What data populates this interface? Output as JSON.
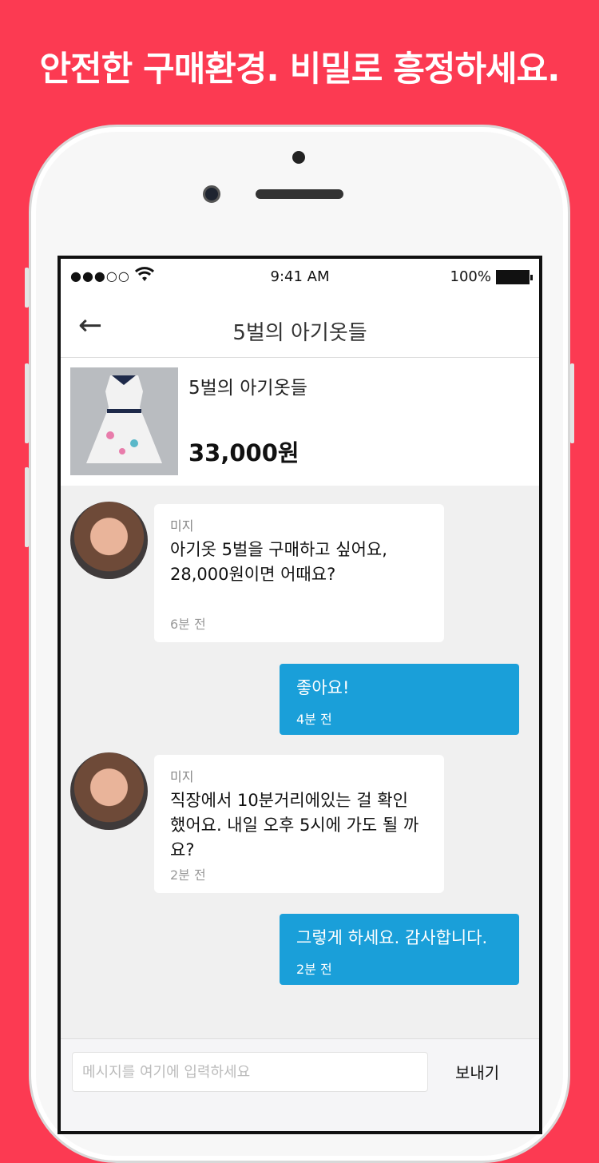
{
  "headline": "안전한 구매환경. 비밀로 흥정하세요.",
  "status_bar": {
    "signal": "●●●○○",
    "time": "9:41 AM",
    "battery": "100%"
  },
  "nav": {
    "title": "5벌의 아기옷들",
    "back_icon": "arrow-left-icon"
  },
  "product": {
    "name": "5벌의 아기옷들",
    "price": "33,000원"
  },
  "messages": [
    {
      "direction": "in",
      "sender": "미지",
      "text": "아기옷 5벌을 구매하고 싶어요, 28,000원이면 어때요?",
      "time": "6분 전"
    },
    {
      "direction": "out",
      "text": "좋아요!",
      "time": "4분 전"
    },
    {
      "direction": "in",
      "sender": "미지",
      "text": "직장에서 10분거리에있는 걸 확인 했어요. 내일 오후 5시에 가도 될 까요?",
      "time": "2분 전"
    },
    {
      "direction": "out",
      "text": "그렇게 하세요. 감사합니다.",
      "time": "2분 전"
    }
  ],
  "composer": {
    "placeholder": "메시지를 여기에 입력하세요",
    "send_label": "보내기"
  },
  "colors": {
    "background": "#fc3a52",
    "outgoing_bubble": "#1a9fd9"
  }
}
